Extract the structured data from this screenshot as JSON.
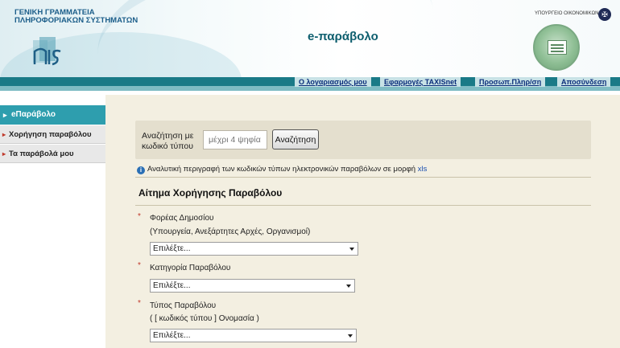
{
  "header": {
    "org_line1": "ΓΕΝΙΚΗ ΓΡΑΜΜΑΤΕΙΑ",
    "org_line2": "ΠΛΗΡΟΦΟΡΙΑΚΩΝ ΣΥΣΤΗΜΑΤΩΝ",
    "app_title": "e-παράβολο",
    "ministry": "ΥΠΟΥΡΓΕΙΟ ΟΙΚΟΝΟΜΙΚΩΝ"
  },
  "nav": {
    "items": [
      {
        "label": "Ο λογαριασμός μου"
      },
      {
        "label": "Εφαρμογές TAXISnet"
      },
      {
        "label": "Προσωπ.Πληρ/ση"
      },
      {
        "label": "Αποσύνδεση"
      }
    ]
  },
  "sidebar": {
    "active": "eΠαράβολο",
    "items": [
      {
        "label": "Χορήγηση παραβόλου"
      },
      {
        "label": "Τα παράβολά μου"
      }
    ]
  },
  "search": {
    "label_line1": "Αναζήτηση με",
    "label_line2": "κωδικό τύπου",
    "placeholder": "μέχρι 4 ψηφία",
    "button": "Αναζήτηση"
  },
  "info": {
    "text": "Αναλυτική περιγραφή των κωδικών τύπων ηλεκτρονικών παραβόλων σε μορφή",
    "link": "xls"
  },
  "form": {
    "title": "Αίτημα Χορήγησης Παραβόλου",
    "required_mark": "*",
    "fields": [
      {
        "label": "Φορέας Δημοσίου",
        "sublabel": "(Υπουργεία, Ανεξάρτητες Αρχές, Οργανισμοί)",
        "value": "Επιλέξτε..."
      },
      {
        "label": "Κατηγορία Παραβόλου",
        "sublabel": "",
        "value": "Επιλέξτε..."
      },
      {
        "label": "Τύπος Παραβόλου",
        "sublabel": "( [ κωδικός τύπου ] Ονομασία )",
        "value": "Επιλέξτε..."
      }
    ]
  }
}
